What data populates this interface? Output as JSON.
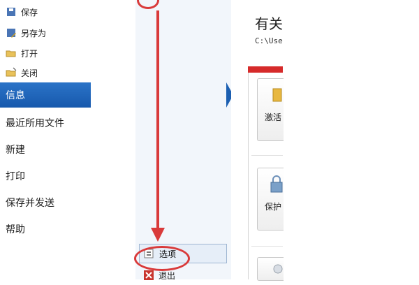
{
  "file_menu": {
    "save": "保存",
    "save_as": "另存为",
    "open": "打开",
    "close": "关闭"
  },
  "categories": {
    "info": "信息",
    "recent": "最近所用文件",
    "new": "新建",
    "print": "打印",
    "save_send": "保存并发送",
    "help": "帮助"
  },
  "bottom_menu": {
    "options": "选项",
    "exit": "退出"
  },
  "content": {
    "heading": "有关",
    "path": "C:\\Use",
    "tile1_label": "激活",
    "tile2_label": "保护"
  },
  "colors": {
    "active_blue": "#1f66ba",
    "annotation_red": "#d93a3a"
  }
}
